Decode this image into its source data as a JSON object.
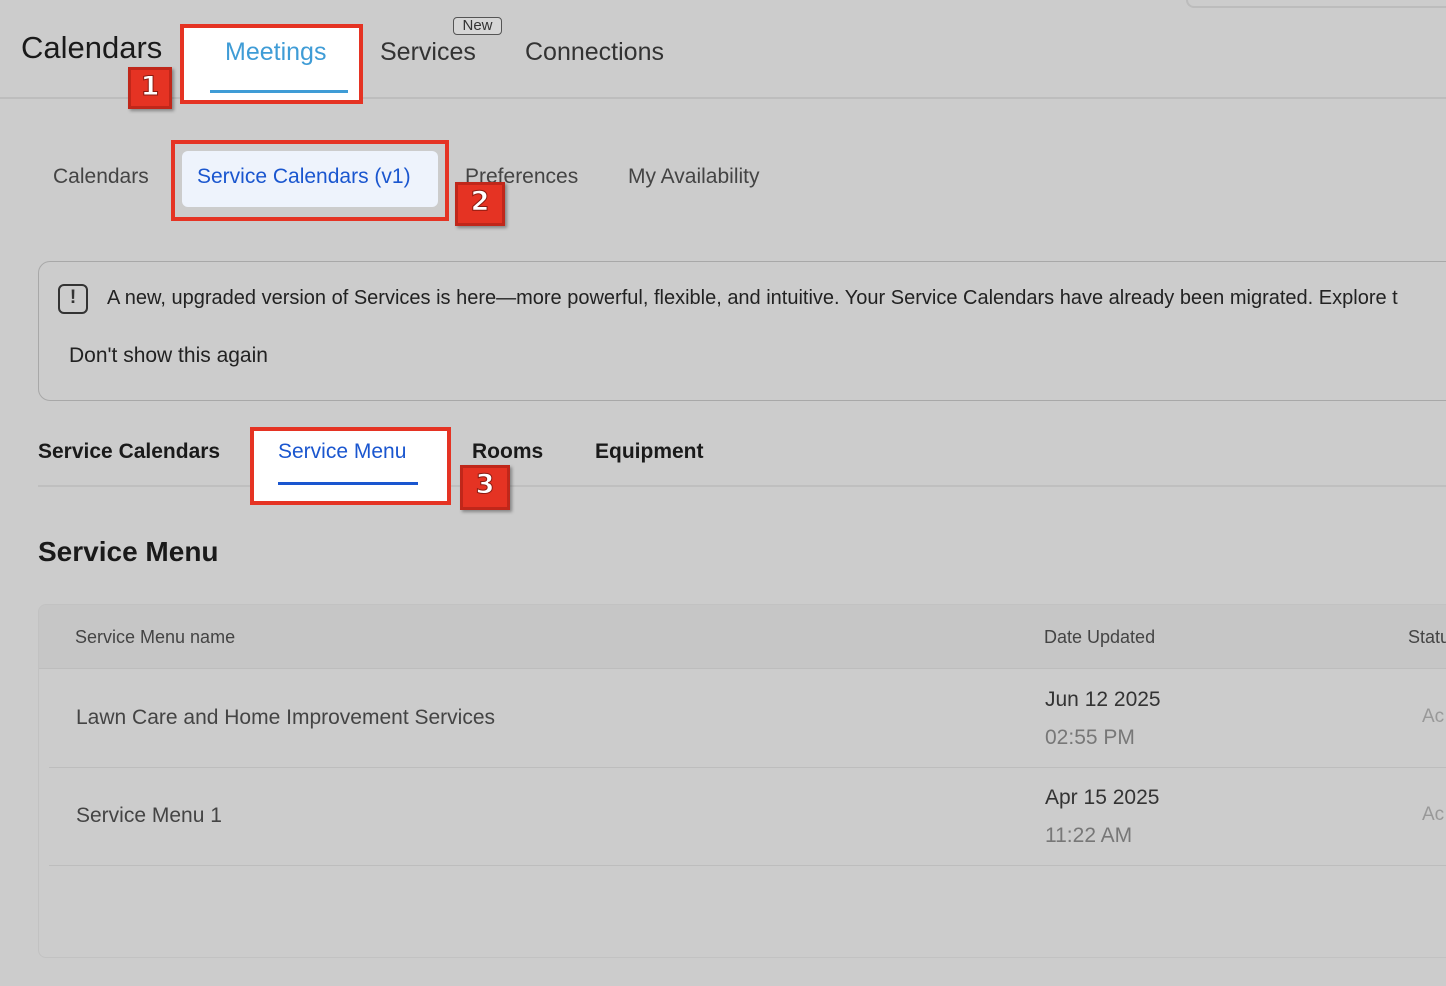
{
  "header": {
    "app_title": "Calendars",
    "tabs": [
      {
        "label": "Meetings",
        "active": true
      },
      {
        "label": "Services",
        "badge": "New"
      },
      {
        "label": "Connections"
      }
    ]
  },
  "sub_nav": {
    "tabs": [
      {
        "label": "Calendars"
      },
      {
        "label": "Service Calendars (v1)",
        "active": true
      },
      {
        "label": "Preferences"
      },
      {
        "label": "My Availability"
      }
    ]
  },
  "banner": {
    "icon": "exclamation-icon",
    "message": "A new, upgraded version of Services is here—more powerful, flexible, and intuitive. Your Service Calendars have already been migrated. Explore t",
    "dismiss_label": "Don't show this again"
  },
  "section_tabs": [
    {
      "label": "Service Calendars"
    },
    {
      "label": "Service Menu",
      "active": true
    },
    {
      "label": "Rooms"
    },
    {
      "label": "Equipment"
    }
  ],
  "section_title": "Service Menu",
  "table": {
    "columns": [
      "Service Menu name",
      "Date Updated",
      "Statu"
    ],
    "rows": [
      {
        "name": "Lawn Care and Home Improvement Services",
        "date": "Jun 12 2025",
        "time": "02:55 PM",
        "status": "Ac"
      },
      {
        "name": "Service Menu 1",
        "date": "Apr 15 2025",
        "time": "11:22 AM",
        "status": "Ac"
      }
    ]
  },
  "annotations": [
    "1",
    "2",
    "3"
  ],
  "colors": {
    "accent_top": "#3f9cd6",
    "accent_blue": "#1a56cf",
    "annotation_red": "#e53323",
    "background": "#cccccc"
  }
}
